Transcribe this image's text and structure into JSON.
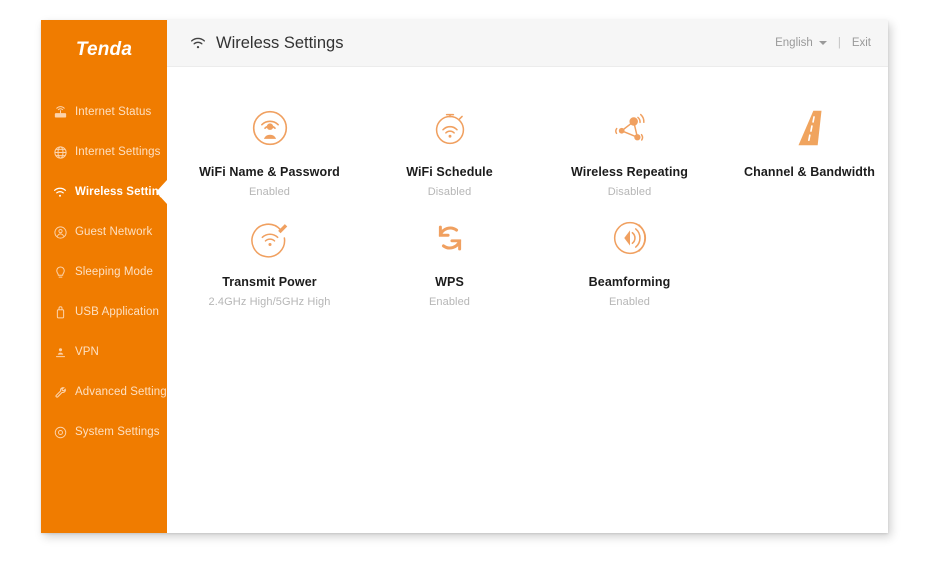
{
  "window": {
    "brand": "Tenda"
  },
  "sidebar": {
    "items": [
      {
        "label": "Internet Status",
        "icon": "router-icon",
        "active": false
      },
      {
        "label": "Internet Settings",
        "icon": "globe-icon",
        "active": false
      },
      {
        "label": "Wireless Settings",
        "icon": "wifi-icon",
        "active": true
      },
      {
        "label": "Guest Network",
        "icon": "guest-user-icon",
        "active": false
      },
      {
        "label": "Sleeping Mode",
        "icon": "moon-bulb-icon",
        "active": false
      },
      {
        "label": "USB Application",
        "icon": "usb-drive-icon",
        "active": false
      },
      {
        "label": "VPN",
        "icon": "vpn-shield-icon",
        "active": false
      },
      {
        "label": "Advanced Settings",
        "icon": "wrench-icon",
        "active": false
      },
      {
        "label": "System Settings",
        "icon": "gear-icon",
        "active": false
      }
    ]
  },
  "header": {
    "title": "Wireless Settings",
    "title_icon": "wifi-icon",
    "language": "English",
    "separator": "|",
    "exit": "Exit"
  },
  "main": {
    "tiles_row1": [
      {
        "label": "WiFi Name & Password",
        "status": "Enabled",
        "icon": "wifi-user-icon"
      },
      {
        "label": "WiFi Schedule",
        "status": "Disabled",
        "icon": "stopwatch-wifi-icon"
      },
      {
        "label": "Wireless Repeating",
        "status": "Disabled",
        "icon": "repeater-nodes-icon"
      },
      {
        "label": "Channel & Bandwidth",
        "status": "",
        "icon": "road-icon"
      }
    ],
    "tiles_row2": [
      {
        "label": "Transmit Power",
        "status": "2.4GHz High/5GHz High",
        "icon": "wifi-power-icon"
      },
      {
        "label": "WPS",
        "status": "Enabled",
        "icon": "sync-arrows-icon"
      },
      {
        "label": "Beamforming",
        "status": "Enabled",
        "icon": "beamforming-icon"
      }
    ]
  },
  "colors": {
    "brand_orange": "#f07c00",
    "icon_orange": "#f0a060",
    "sidebar_text": "#fde0c2",
    "header_bg": "#f6f6f6",
    "status_gray": "#b6b6b6"
  }
}
